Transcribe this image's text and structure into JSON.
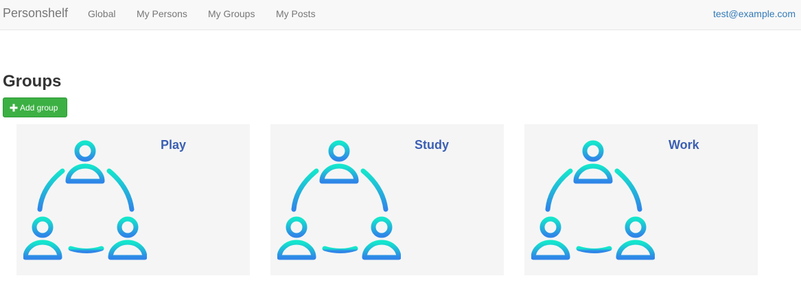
{
  "navbar": {
    "brand": "Personshelf",
    "links": [
      "Global",
      "My Persons",
      "My Groups",
      "My Posts"
    ],
    "user_email": "test@example.com"
  },
  "main": {
    "title": "Groups",
    "add_button_label": "Add group",
    "add_button_icon": "plus-icon"
  },
  "groups": [
    {
      "name": "Play",
      "icon": "group-icon"
    },
    {
      "name": "Study",
      "icon": "group-icon"
    },
    {
      "name": "Work",
      "icon": "group-icon"
    }
  ],
  "colors": {
    "accent_green": "#3cb043",
    "link_blue": "#3b5fb3",
    "icon_gradient_start": "#14e6cc",
    "icon_gradient_end": "#2f86e8"
  }
}
